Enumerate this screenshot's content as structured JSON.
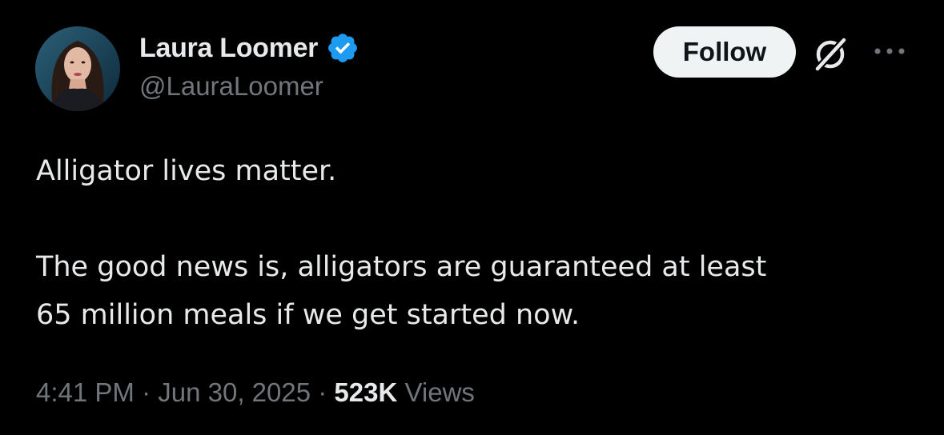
{
  "author": {
    "display_name": "Laura Loomer",
    "handle": "@LauraLoomer",
    "verified_icon": "verified-badge-icon",
    "verified_color": "#1d9bf0"
  },
  "actions": {
    "follow_label": "Follow",
    "grok_icon": "grok-icon",
    "more_icon": "more-horizontal-icon"
  },
  "tweet": {
    "paragraphs": [
      [
        "Alligator lives matter."
      ],
      [
        "The good news is, alligators are guaranteed at least",
        "65 million meals if we get started now."
      ]
    ]
  },
  "meta": {
    "time": "4:41 PM",
    "separator": " · ",
    "date": "Jun 30, 2025",
    "views_count": "523K",
    "views_label": "Views"
  },
  "colors": {
    "background": "#000000",
    "text_primary": "#e7e9ea",
    "text_secondary": "#71767b",
    "follow_bg": "#eff3f4",
    "follow_text": "#0f1419"
  }
}
